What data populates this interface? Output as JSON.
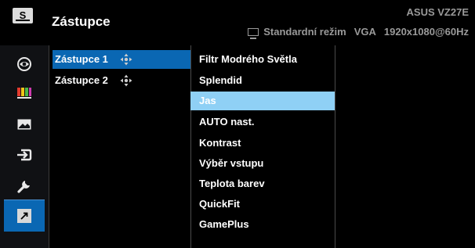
{
  "header": {
    "logo": "S",
    "title": "Zástupce",
    "model": "ASUS VZ27E",
    "mode": "Standardní režim",
    "input": "VGA",
    "resolution": "1920x1080@60Hz"
  },
  "sidebar": {
    "items": [
      {
        "icon": "eye-icon"
      },
      {
        "icon": "color-bars-icon"
      },
      {
        "icon": "image-icon"
      },
      {
        "icon": "input-icon"
      },
      {
        "icon": "wrench-icon"
      },
      {
        "icon": "shortcut-arrow-icon",
        "active": true
      }
    ]
  },
  "shortcuts": {
    "items": [
      {
        "label": "Zástupce 1",
        "selected": true
      },
      {
        "label": "Zástupce 2",
        "selected": false
      }
    ]
  },
  "options": {
    "items": [
      "Filtr Modrého Světla",
      "Splendid",
      "Jas",
      "AUTO nast.",
      "Kontrast",
      "Výběr vstupu",
      "Teplota barev",
      "QuickFit",
      "GamePlus"
    ],
    "selected": "Jas"
  },
  "colors": {
    "background": "#000000",
    "sidebar": "#101114",
    "accent_blue": "#0a67b3",
    "highlight_light_blue": "#8fd0f5",
    "status_gray": "#9a9a9a"
  }
}
